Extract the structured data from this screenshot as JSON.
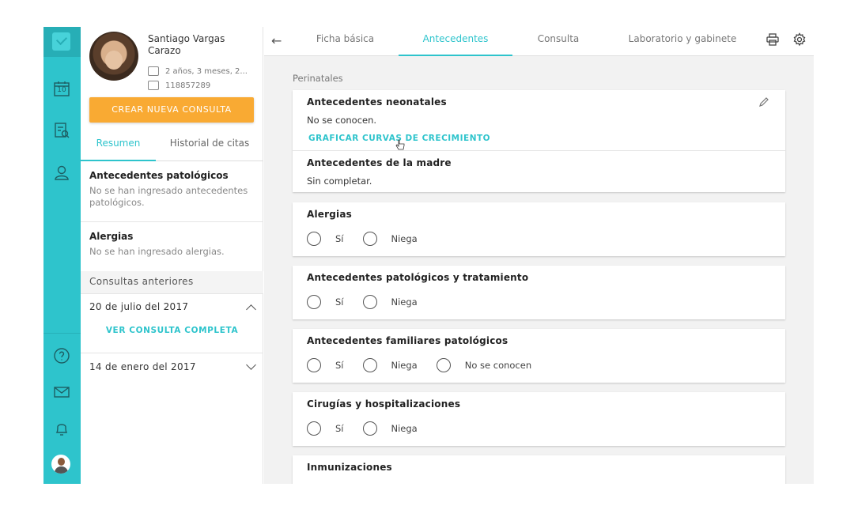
{
  "rail": {
    "calendar_day": "10"
  },
  "patient": {
    "name": "Santiago Vargas Carazo",
    "age": "2 años, 3 meses, 2...",
    "id": "118857289"
  },
  "actions": {
    "new_consult": "CREAR NUEVA CONSULTA"
  },
  "panel_tabs": [
    "Resumen",
    "Historial de citas"
  ],
  "summary": {
    "pathologic_title": "Antecedentes patológicos",
    "pathologic_text": "No se han ingresado antecedentes patológicos.",
    "allergies_title": "Alergias",
    "allergies_text": "No se han ingresado alergias."
  },
  "previous": {
    "header": "Consultas anteriores",
    "items": [
      {
        "date": "20 de julio del 2017",
        "link": "VER CONSULTA COMPLETA"
      },
      {
        "date": "14 de enero del 2017"
      }
    ]
  },
  "main_tabs": [
    "Ficha básica",
    "Antecedentes",
    "Consulta",
    "Laboratorio y gabinete"
  ],
  "sections": {
    "perinatales": "Perinatales",
    "neonatal_title": "Antecedentes neonatales",
    "neonatal_text": "No se conocen.",
    "growth_link": "GRAFICAR CURVAS DE CRECIMIENTO",
    "mother_title": "Antecedentes de la madre",
    "mother_text": "Sin completar.",
    "allergies_title": "Alergias",
    "path_treat_title": "Antecedentes patológicos y tratamiento",
    "family_title": "Antecedentes familiares patológicos",
    "surgery_title": "Cirugías y hospitalizaciones",
    "immun_title": "Inmunizaciones"
  },
  "options": {
    "yes": "Sí",
    "deny": "Niega",
    "unknown": "No se conocen"
  },
  "colors": {
    "accent": "#2ec4cc",
    "primary_button": "#f9aa33"
  }
}
